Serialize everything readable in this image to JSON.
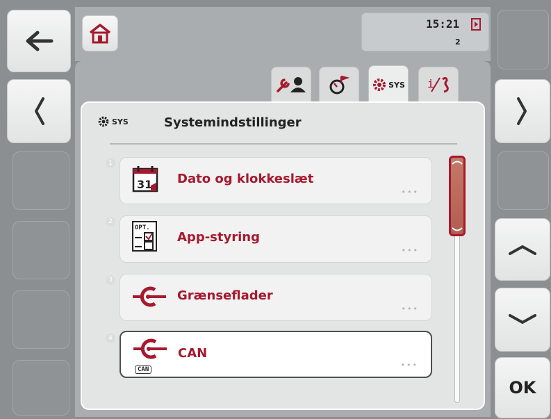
{
  "header": {
    "time": "15:21",
    "sub_value": "2"
  },
  "tabs": [
    {
      "icon": "wrench-person-icon",
      "active": false
    },
    {
      "icon": "gauge-flag-icon",
      "active": false
    },
    {
      "icon": "gear-sys-icon",
      "label": "SYS",
      "active": true
    },
    {
      "icon": "info-wrench-icon",
      "label": "i/",
      "active": false
    }
  ],
  "panel": {
    "title": "Systemindstillinger",
    "title_icon_label": "SYS"
  },
  "items": [
    {
      "number": "1",
      "label": "Dato og klokkeslæt",
      "dots": "•••",
      "icon": "calendar-icon",
      "icon_text": "31"
    },
    {
      "number": "2",
      "label": "App-styring",
      "dots": "•••",
      "icon": "opt-checklist-icon",
      "icon_text": "OPT."
    },
    {
      "number": "3",
      "label": "Grænseflader",
      "dots": "•••",
      "icon": "interface-icon"
    },
    {
      "number": "4",
      "label": "CAN",
      "dots": "•••",
      "icon": "can-interface-icon",
      "icon_text": "CAN"
    }
  ],
  "buttons": {
    "ok_label": "OK"
  },
  "scroll": {
    "position": 0.0,
    "visible_fraction": 0.33
  },
  "colors": {
    "accent": "#a6192e",
    "background": "#8b8f92",
    "panel": "#e3e5e4"
  }
}
